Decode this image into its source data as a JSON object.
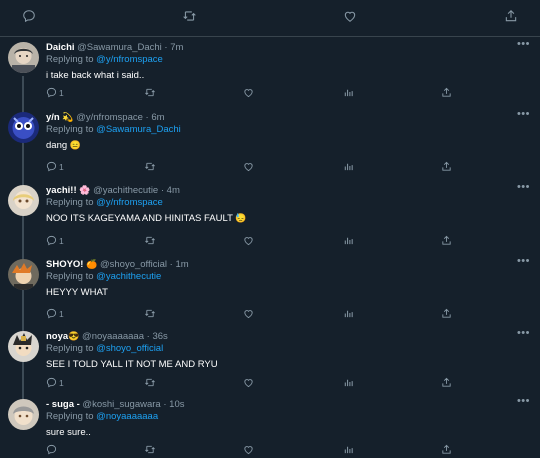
{
  "tweets": [
    {
      "name": "Daichi",
      "handle": "@Sawamura_Dachi",
      "time": "· 7m",
      "reply_prefix": "Replying to ",
      "reply_to": "@y/nfromspace",
      "text": "i take back what i said..",
      "reply_count": "1"
    },
    {
      "name": "y/n",
      "name_emoji": "💫",
      "handle": "@y/nfromspace",
      "time": "· 6m",
      "reply_prefix": "Replying to ",
      "reply_to": "@Sawamura_Dachi",
      "text": "dang",
      "text_emoji": "😑",
      "reply_count": "1"
    },
    {
      "name": "yachi!!",
      "name_emoji": "🌸",
      "handle": "@yachithecutie",
      "time": "· 4m",
      "reply_prefix": "Replying to ",
      "reply_to": "@y/nfromspace",
      "text": "NOO ITS KAGEYAMA AND HINITAS FAULT",
      "text_emoji": "😓",
      "reply_count": "1"
    },
    {
      "name": "SHOYO!",
      "name_emoji": "🍊",
      "handle": "@shoyo_official",
      "time": "· 1m",
      "reply_prefix": "Replying to ",
      "reply_to": "@yachithecutie",
      "text": "HEYYY WHAT",
      "reply_count": "1"
    },
    {
      "name": "noya",
      "name_emoji": "😎",
      "handle": "@noyaaaaaaa",
      "time": "· 36s",
      "reply_prefix": "Replying to ",
      "reply_to": "@shoyo_official",
      "text": "SEE I TOLD YALL IT NOT ME AND RYU",
      "reply_count": "1"
    },
    {
      "name": "- suga -",
      "handle": "@koshi_sugawara",
      "time": "· 10s",
      "reply_prefix": "Replying to ",
      "reply_to": "@noyaaaaaaa",
      "text": "sure sure..",
      "reply_count": ""
    }
  ],
  "more_label": "•••",
  "colors": {
    "background": "#15202b",
    "accent": "#1da1f2",
    "muted": "#8899a6",
    "text": "#ffffff"
  }
}
